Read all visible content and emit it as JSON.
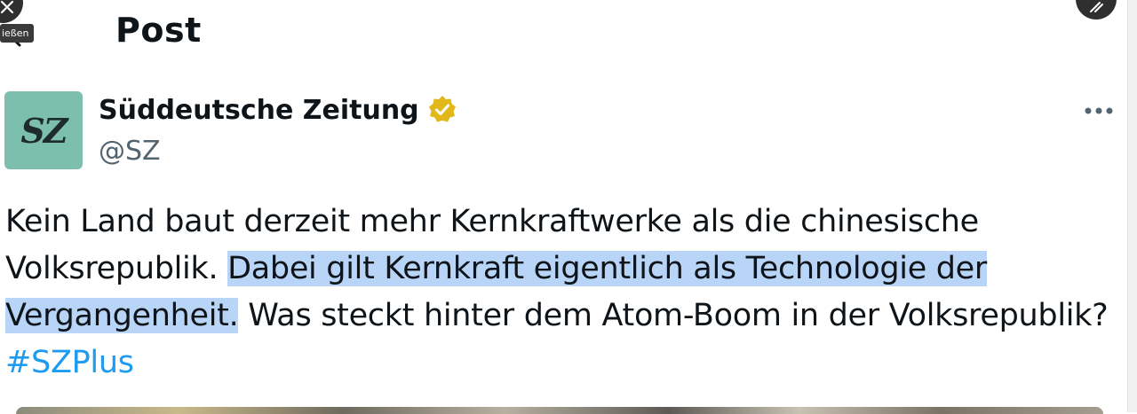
{
  "window": {
    "close_tooltip": "ießen"
  },
  "header": {
    "title": "Post"
  },
  "post": {
    "author": {
      "avatar_text": "SZ",
      "display_name": "Süddeutsche Zeitung",
      "handle": "@SZ",
      "verified": true,
      "verified_badge_color": "#e2b719"
    },
    "text": {
      "part1": "Kein Land baut derzeit mehr Kernkraftwerke als die chinesische Volksrepublik. ",
      "highlighted": "Dabei gilt Kernkraft eigentlich als Technologie der Vergangenheit.",
      "part2": " Was steckt hinter dem Atom-Boom in der Volksrepublik?",
      "hashtag": "#SZPlus"
    }
  },
  "colors": {
    "hashtag": "#1d9bf0",
    "selection_highlight": "#b8d4f7",
    "avatar_background": "#7dbfad",
    "handle_gray": "#536471"
  },
  "icons": {
    "close": "close-icon",
    "back": "back-arrow-icon",
    "resize": "resize-icon",
    "verified": "verified-badge-icon",
    "more": "more-icon"
  }
}
